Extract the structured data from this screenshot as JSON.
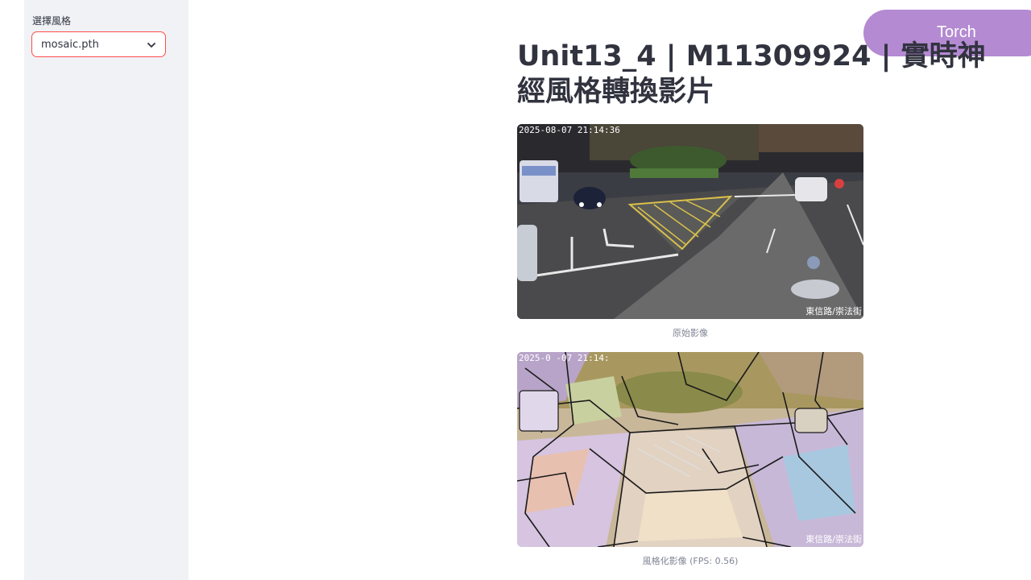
{
  "sidebar": {
    "style_label": "選擇風格",
    "style_selected": "mosaic.pth"
  },
  "badge": {
    "text": "Torch"
  },
  "main": {
    "title": "Unit13_4 | M11309924 | 實時神經風格轉換影片",
    "original": {
      "timestamp": "2025-08-07 21:14:36",
      "location": "東信路/崇法街",
      "caption": "原始影像"
    },
    "styled": {
      "timestamp": "2025-0 -07 21:14:",
      "location": "東信路/崇法街",
      "caption": "風格化影像 (FPS: 0.56)"
    }
  },
  "colors": {
    "sidebar_bg": "#f0f2f6",
    "select_border": "#ff4b4b",
    "badge_bg": "#b48ad2",
    "text": "#31333f",
    "caption": "#808495"
  }
}
